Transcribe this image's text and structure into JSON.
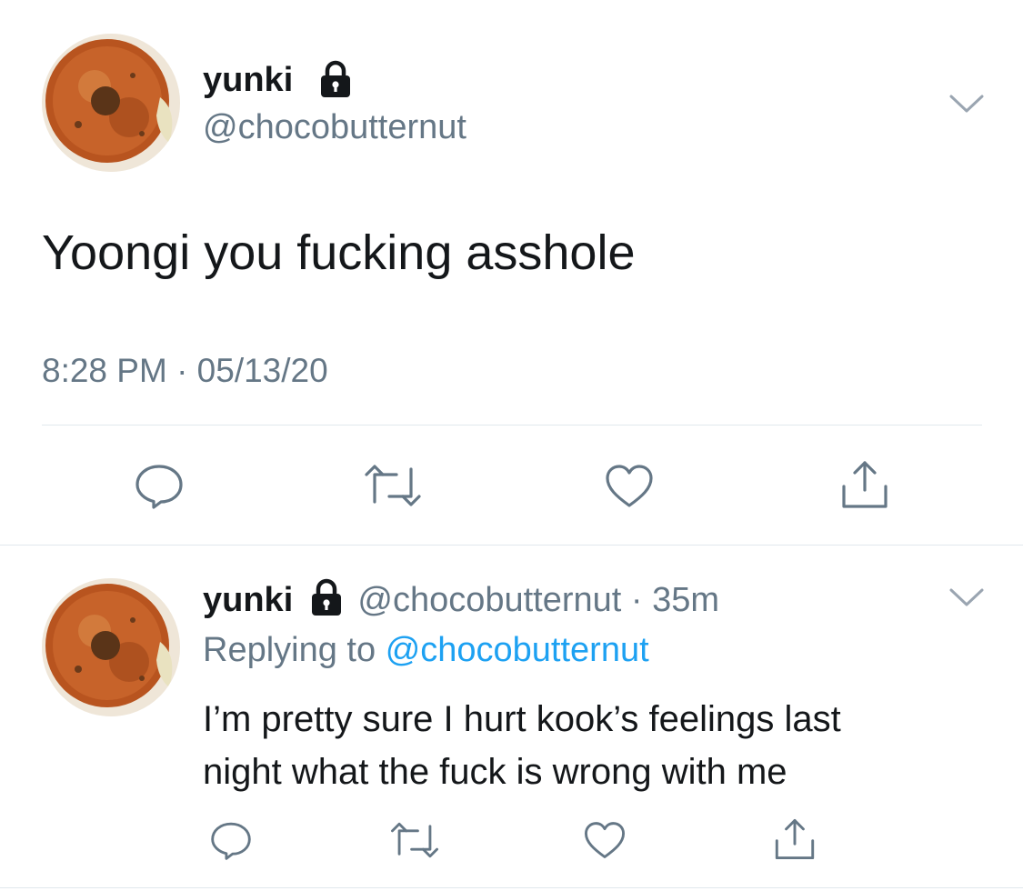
{
  "main_tweet": {
    "display_name": "yunki",
    "handle": "@chocobutternut",
    "text": "Yoongi you fucking asshole",
    "timestamp": "8:28 PM · 05/13/20",
    "protected_icon": "lock-icon",
    "more_icon": "chevron-down-icon",
    "actions": [
      "reply-icon",
      "retweet-icon",
      "like-icon",
      "share-icon"
    ]
  },
  "reply_tweet": {
    "display_name": "yunki",
    "handle": "@chocobutternut",
    "separator": "·",
    "time_ago": "35m",
    "replying_prefix": "Replying to",
    "replying_handle": "@chocobutternut",
    "text_line1": "I’m pretty sure I hurt kook’s feelings last",
    "text_line2": "night what the fuck is wrong with me",
    "protected_icon": "lock-icon",
    "more_icon": "chevron-down-icon",
    "actions": [
      "reply-icon",
      "retweet-icon",
      "like-icon",
      "share-icon"
    ]
  },
  "colors": {
    "text": "#14171a",
    "muted": "#657786",
    "link": "#1da1f2",
    "divider": "#e1e8ed",
    "icon": "#657786"
  }
}
